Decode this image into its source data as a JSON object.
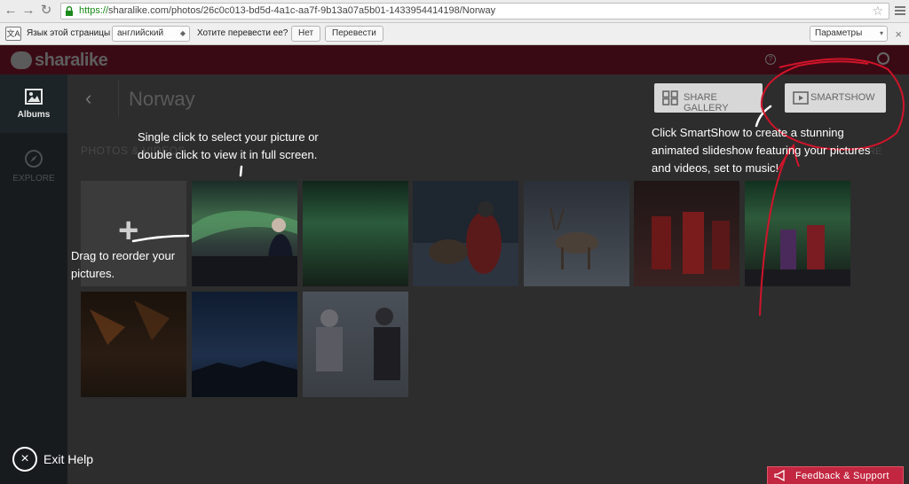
{
  "browser": {
    "url_https": "https://",
    "url_rest": "sharalike.com/photos/26c0c013-bd5d-4a1c-aa7f-9b13a07a5b01-1433954414198/Norway",
    "star_icon": "star-icon"
  },
  "translate_bar": {
    "icon_text": "文A",
    "page_lang_label": "Язык этой страницы",
    "page_lang_value": "английский",
    "question": "Хотите перевести ее?",
    "no_button": "Нет",
    "translate_button": "Перевести",
    "options_value": "Параметры",
    "close_icon": "×"
  },
  "app": {
    "logo_text": "sharalike"
  },
  "sidebar": {
    "items": [
      {
        "label": "Albums",
        "icon": "albums-icon"
      },
      {
        "label": "EXPLORE",
        "icon": "compass-icon"
      }
    ]
  },
  "header": {
    "back_icon": "‹",
    "title": "Norway",
    "share_gallery_label": "SHARE GALLERY",
    "smartshow_label": "SMARTSHOW"
  },
  "subtabs": {
    "left": "PHOTOS & VIDEOS",
    "right": "RE"
  },
  "grid": {
    "add_symbol": "+",
    "photos": [
      {
        "scene": "aurora-person-1",
        "bg": "#2a3a33"
      },
      {
        "scene": "green-aurora",
        "bg": "#1f3a2c"
      },
      {
        "scene": "reindeer-group",
        "bg": "#1e2630"
      },
      {
        "scene": "reindeer-snow",
        "bg": "#2b3038"
      },
      {
        "scene": "red-coat-group",
        "bg": "#2a2020"
      },
      {
        "scene": "aurora-two-people",
        "bg": "#1b2a20"
      },
      {
        "scene": "campfire",
        "bg": "#2a1a10"
      },
      {
        "scene": "fjord-dusk",
        "bg": "#18233a"
      },
      {
        "scene": "snow-people",
        "bg": "#3a3d42"
      }
    ]
  },
  "help": {
    "select_tip_line1": "Single click to select your picture or",
    "select_tip_line2": "double click to view it in full screen.",
    "reorder_tip_line1": "Drag to reorder your",
    "reorder_tip_line2": "pictures.",
    "smartshow_tip_line1": "Click SmartShow to create a stunning",
    "smartshow_tip_line2": "animated slideshow featuring your pictures",
    "smartshow_tip_line3": "and videos, set to music!",
    "exit_label": "Exit Help"
  },
  "feedback": {
    "label": "Feedback & Support"
  },
  "colors": {
    "brand_top": "#3a0a14",
    "feedback": "#c22640",
    "annotation": "#d0142a"
  }
}
